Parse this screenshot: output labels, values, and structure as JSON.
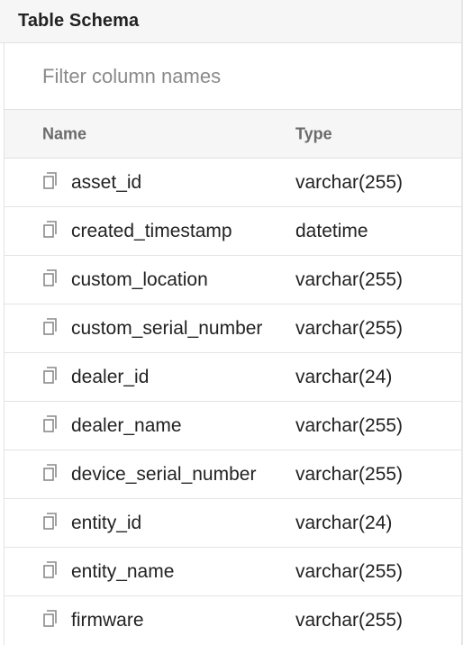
{
  "panel": {
    "title": "Table Schema"
  },
  "filter": {
    "placeholder": "Filter column names",
    "value": ""
  },
  "table": {
    "headers": {
      "name": "Name",
      "type": "Type"
    },
    "rows": [
      {
        "name": "asset_id",
        "type": "varchar(255)",
        "icon": "copy-icon"
      },
      {
        "name": "created_timestamp",
        "type": "datetime",
        "icon": "copy-icon"
      },
      {
        "name": "custom_location",
        "type": "varchar(255)",
        "icon": "copy-icon"
      },
      {
        "name": "custom_serial_number",
        "type": "varchar(255)",
        "icon": "copy-icon"
      },
      {
        "name": "dealer_id",
        "type": "varchar(24)",
        "icon": "copy-icon"
      },
      {
        "name": "dealer_name",
        "type": "varchar(255)",
        "icon": "copy-icon"
      },
      {
        "name": "device_serial_number",
        "type": "varchar(255)",
        "icon": "copy-icon"
      },
      {
        "name": "entity_id",
        "type": "varchar(24)",
        "icon": "copy-icon"
      },
      {
        "name": "entity_name",
        "type": "varchar(255)",
        "icon": "copy-icon"
      },
      {
        "name": "firmware",
        "type": "varchar(255)",
        "icon": "copy-icon"
      }
    ]
  }
}
